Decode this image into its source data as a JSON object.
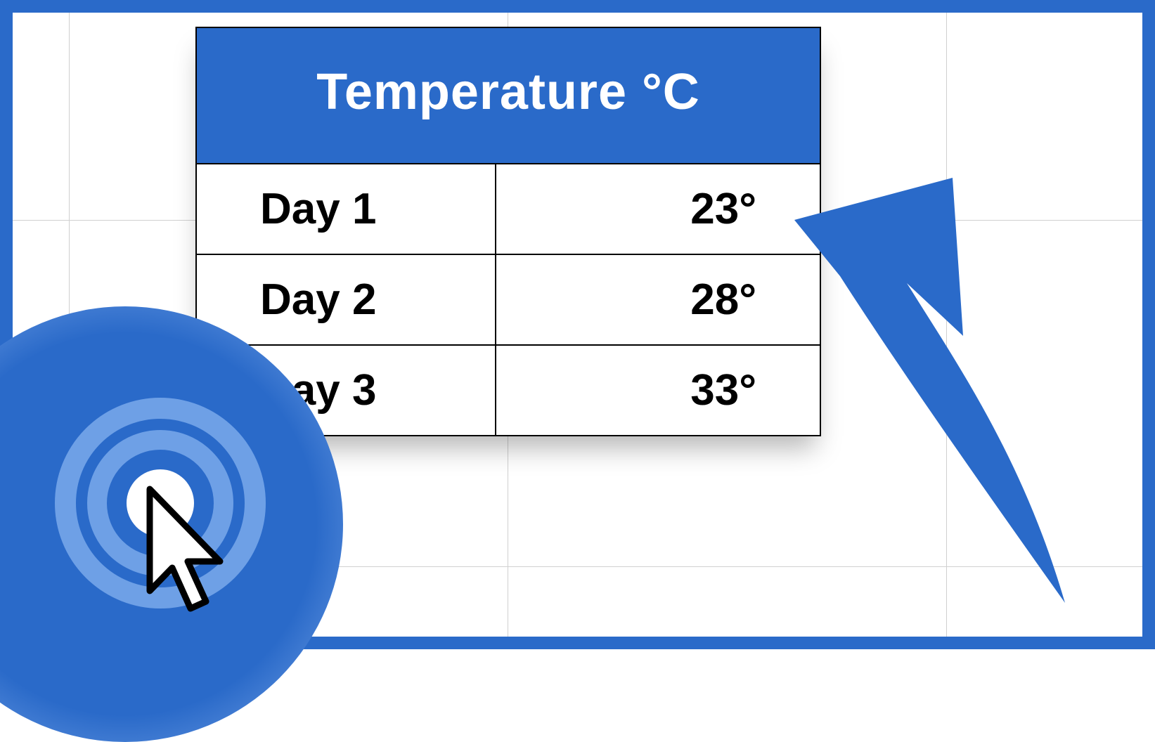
{
  "table": {
    "header": "Temperature °C",
    "rows": [
      {
        "label": "Day 1",
        "value": "23°"
      },
      {
        "label": "Day 2",
        "value": "28°"
      },
      {
        "label": "Day 3",
        "value": "33°"
      }
    ]
  },
  "colors": {
    "brand_blue": "#2a6ac9",
    "light_blue": "#6ea0e6"
  }
}
